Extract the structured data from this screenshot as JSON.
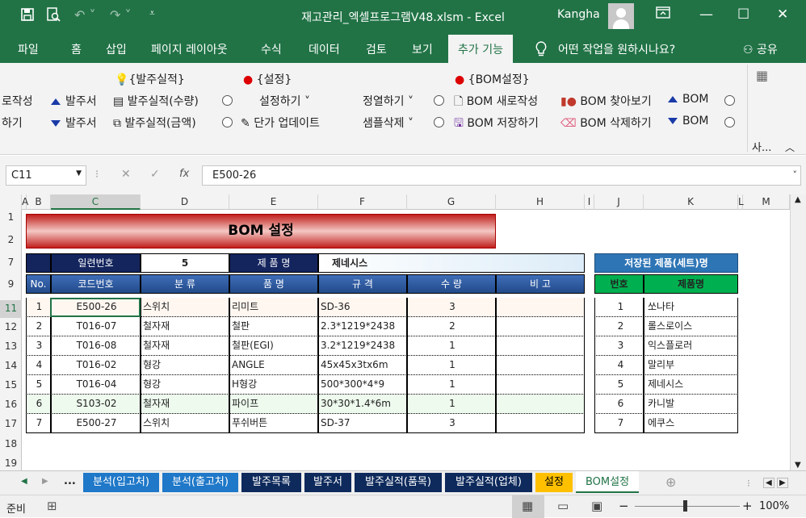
{
  "titlebar": {
    "title": "재고관리_엑셀프로그램V48.xlsm  -  Excel",
    "user": "Kangha"
  },
  "tabs": [
    "파일",
    "홈",
    "삽입",
    "페이지 레이아웃",
    "수식",
    "데이터",
    "검토",
    "보기",
    "추가 기능",
    "어떤 작업을 원하시나요?",
    "공유"
  ],
  "ribbon": {
    "col0": [
      "로작성",
      "하기"
    ],
    "col1": [
      "발주서",
      "발주서"
    ],
    "col2_head": "{발주실적}",
    "col2": [
      "발주실적(수량)",
      "발주실적(금액)"
    ],
    "col3_head": "{설정}",
    "col3": [
      "설정하기",
      "단가 업데이트"
    ],
    "col4": [
      "정열하기",
      "샘플삭제"
    ],
    "col5_head": "{BOM설정}",
    "col5": [
      "BOM 새로작성",
      "BOM 저장하기"
    ],
    "col6": [
      "BOM 찾아보기",
      "BOM 삭제하기"
    ],
    "col7": [
      "BOM",
      "BOM"
    ],
    "last": "사..."
  },
  "formula": {
    "namebox": "C11",
    "content": "E500-26"
  },
  "colhdrs": [
    "A",
    "B",
    "C",
    "D",
    "E",
    "F",
    "G",
    "H",
    "I",
    "J",
    "K",
    "L",
    "M"
  ],
  "rowhdrs": [
    "1",
    "2",
    "7",
    "9",
    "11",
    "12",
    "13",
    "14",
    "15",
    "16",
    "17",
    "18",
    "19"
  ],
  "sheet": {
    "banner": "BOM 설정",
    "serial_label": "일련번호",
    "serial_value": "5",
    "product_label": "제 품 명",
    "product_value": "제네시스",
    "headers": [
      "No.",
      "코드번호",
      "분  류",
      "품  명",
      "규  격",
      "수  량",
      "비  고"
    ],
    "rows": [
      {
        "no": "1",
        "code": "E500-26",
        "cat": "스위치",
        "name": "리미트",
        "spec": "SD-36",
        "qty": "3"
      },
      {
        "no": "2",
        "code": "T016-07",
        "cat": "철자재",
        "name": "철판",
        "spec": "2.3*1219*2438",
        "qty": "2"
      },
      {
        "no": "3",
        "code": "T016-08",
        "cat": "철자재",
        "name": "철판(EGI)",
        "spec": "3.2*1219*2438",
        "qty": "1"
      },
      {
        "no": "4",
        "code": "T016-02",
        "cat": "형강",
        "name": "ANGLE",
        "spec": "45x45x3tx6m",
        "qty": "1"
      },
      {
        "no": "5",
        "code": "T016-04",
        "cat": "형강",
        "name": "H형강",
        "spec": "500*300*4*9",
        "qty": "1"
      },
      {
        "no": "6",
        "code": "S103-02",
        "cat": "철자재",
        "name": "파이프",
        "spec": "30*30*1.4*6m",
        "qty": "1"
      },
      {
        "no": "7",
        "code": "E500-27",
        "cat": "스위치",
        "name": "푸쉬버튼",
        "spec": "SD-37",
        "qty": "3"
      }
    ],
    "saved_title": "저장된 제품(세트)명",
    "saved_headers": [
      "번호",
      "제품명"
    ],
    "saved": [
      {
        "no": "1",
        "name": "쏘나타"
      },
      {
        "no": "2",
        "name": "롤스로이스"
      },
      {
        "no": "3",
        "name": "익스플로러"
      },
      {
        "no": "4",
        "name": "말리부"
      },
      {
        "no": "5",
        "name": "제네시스"
      },
      {
        "no": "6",
        "name": "카니발"
      },
      {
        "no": "7",
        "name": "에쿠스"
      }
    ]
  },
  "sheettabs": [
    "...",
    "분석(입고처)",
    "분석(출고처)",
    "발주목록",
    "발주서",
    "발주실적(품목)",
    "발주실적(업체)",
    "설정",
    "BOM설정"
  ],
  "status": {
    "ready": "준비",
    "zoom": "100%"
  },
  "colors": {
    "excel_green": "#217346",
    "navy": "#14255e",
    "header_blue": "#2e5a9e",
    "green_header": "#00b050"
  }
}
